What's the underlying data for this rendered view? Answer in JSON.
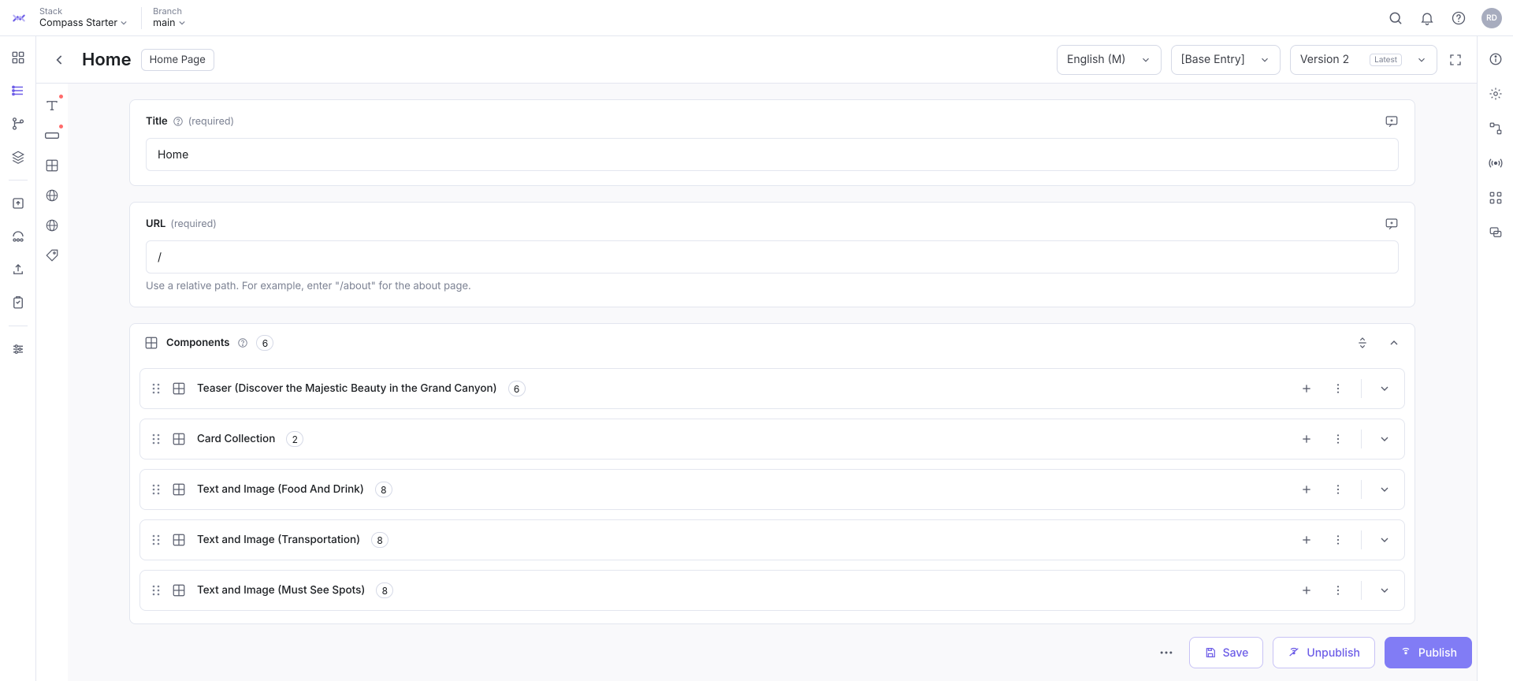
{
  "topstrip": {
    "stack_label": "Stack",
    "stack_value": "Compass Starter",
    "branch_label": "Branch",
    "branch_value": "main",
    "avatar": "RD"
  },
  "header": {
    "title": "Home",
    "crumb_chip": "Home Page",
    "language": "English (M)",
    "base_entry": "[Base Entry]",
    "version": "Version 2",
    "version_badge": "Latest"
  },
  "fields": {
    "title": {
      "label": "Title",
      "required": "(required)",
      "value": "Home"
    },
    "url": {
      "label": "URL",
      "required": "(required)",
      "value": "/",
      "hint": "Use a relative path. For example, enter \"/about\" for the about page."
    }
  },
  "components": {
    "label": "Components",
    "count": "6",
    "items": [
      {
        "title": "Teaser (Discover the Majestic Beauty in the Grand Canyon)",
        "count": "6"
      },
      {
        "title": "Card Collection",
        "count": "2"
      },
      {
        "title": "Text and Image (Food And Drink)",
        "count": "8"
      },
      {
        "title": "Text and Image (Transportation)",
        "count": "8"
      },
      {
        "title": "Text and Image (Must See Spots)",
        "count": "8"
      }
    ]
  },
  "actions": {
    "save": "Save",
    "unpublish": "Unpublish",
    "publish": "Publish"
  }
}
